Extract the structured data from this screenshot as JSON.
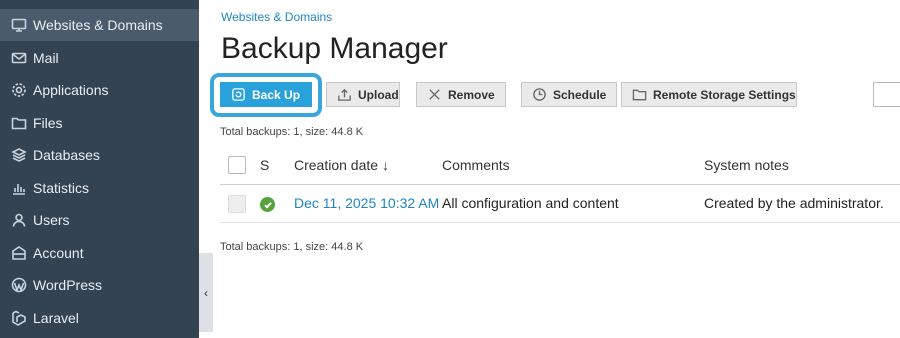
{
  "sidebar": {
    "items": [
      {
        "label": "Websites & Domains",
        "icon": "monitor-icon"
      },
      {
        "label": "Mail",
        "icon": "mail-icon"
      },
      {
        "label": "Applications",
        "icon": "gear-icon"
      },
      {
        "label": "Files",
        "icon": "folder-icon"
      },
      {
        "label": "Databases",
        "icon": "database-icon"
      },
      {
        "label": "Statistics",
        "icon": "bar-chart-icon"
      },
      {
        "label": "Users",
        "icon": "user-icon"
      },
      {
        "label": "Account",
        "icon": "account-icon"
      },
      {
        "label": "WordPress",
        "icon": "wordpress-icon"
      },
      {
        "label": "Laravel",
        "icon": "laravel-icon"
      }
    ],
    "collapse_glyph": "‹"
  },
  "breadcrumb": "Websites & Domains",
  "page_title": "Backup Manager",
  "toolbar": {
    "back_up": "Back Up",
    "upload": "Upload",
    "remove": "Remove",
    "schedule": "Schedule",
    "remote_storage": "Remote Storage Settings"
  },
  "summary_top": "Total backups: 1, size: 44.8 K",
  "summary_bottom": "Total backups: 1, size: 44.8 K",
  "table": {
    "columns": {
      "status": "S",
      "creation_date": "Creation date ↓",
      "comments": "Comments",
      "system_notes": "System notes"
    },
    "rows": [
      {
        "status": "ok",
        "creation_date": "Dec 11, 2025 10:32 AM",
        "comments": "All configuration and content",
        "system_notes": "Created by the administrator."
      }
    ]
  },
  "colors": {
    "sidebar_bg": "#344352",
    "accent": "#29a2dc",
    "link": "#1f86c3",
    "success": "#54a33b"
  }
}
